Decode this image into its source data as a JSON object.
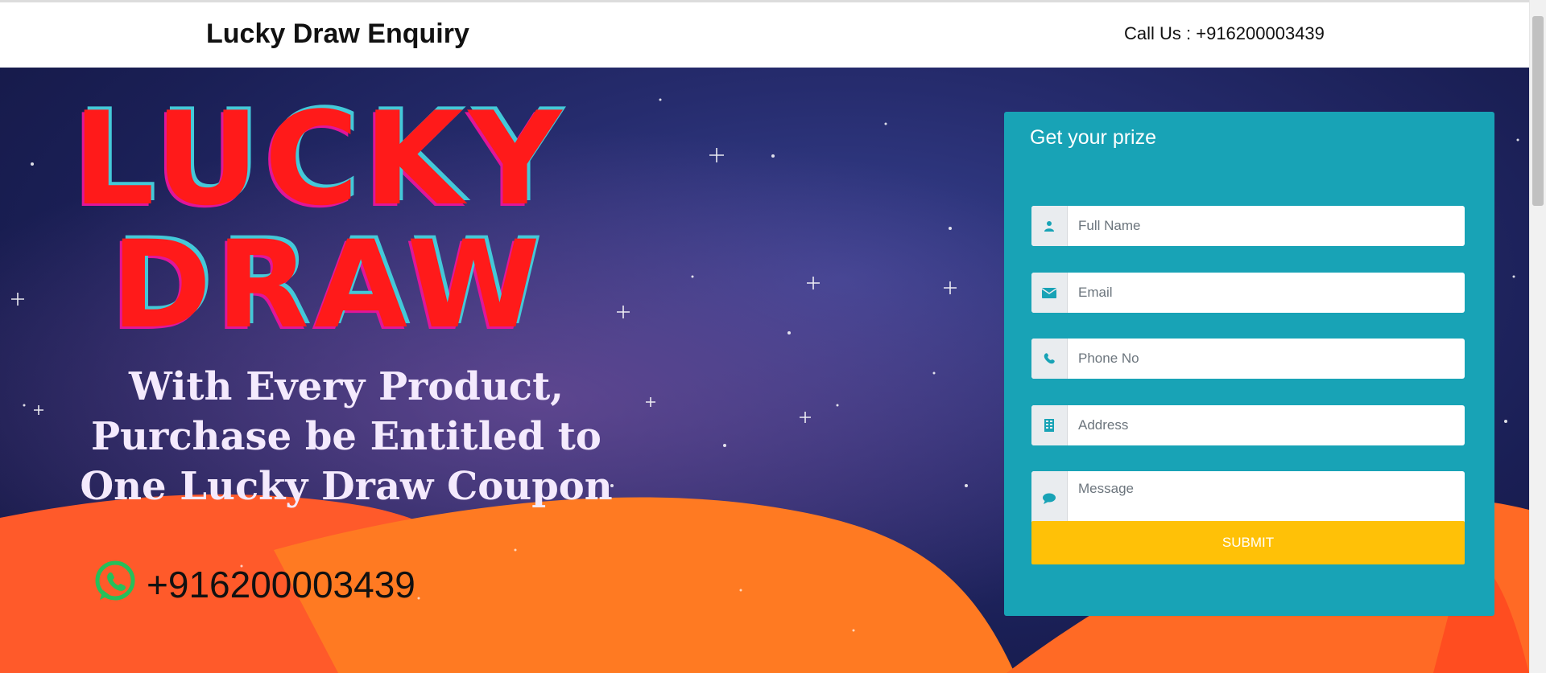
{
  "header": {
    "brand": "Lucky Draw Enquiry",
    "call_us": "Call Us : +916200003439"
  },
  "hero": {
    "headline_line1": "LUCKY",
    "headline_line2": "DRAW",
    "tagline_line1": "With Every Product,",
    "tagline_line2": "Purchase be Entitled to",
    "tagline_line3": "One Lucky Draw Coupon",
    "whatsapp_number": "+916200003439",
    "whatsapp_icon": "whatsapp-icon"
  },
  "form": {
    "title": "Get your prize",
    "fields": [
      {
        "placeholder": "Full Name",
        "icon": "user-icon"
      },
      {
        "placeholder": "Email",
        "icon": "envelope-icon"
      },
      {
        "placeholder": "Phone No",
        "icon": "phone-icon"
      },
      {
        "placeholder": "Address",
        "icon": "building-icon"
      },
      {
        "placeholder": "Message",
        "icon": "comment-icon"
      }
    ],
    "submit_label": "SUBMIT"
  },
  "colors": {
    "card": "#18a3b6",
    "submit": "#ffc107",
    "headline": "#ff1a1a",
    "hills": "#ff7a22"
  }
}
